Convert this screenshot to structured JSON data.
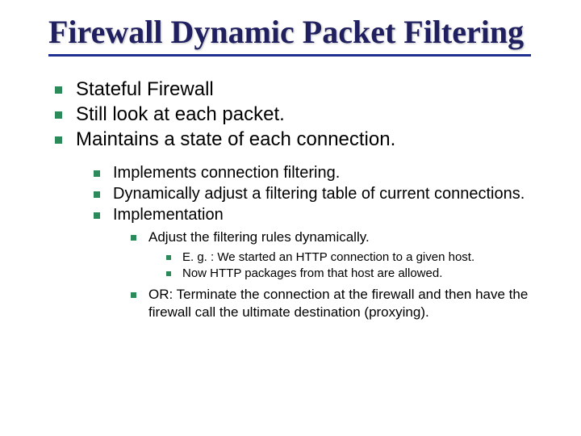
{
  "title": "Firewall Dynamic Packet Filtering",
  "l1": {
    "a": "Stateful Firewall",
    "b": "Still look at each packet.",
    "c": "Maintains a state of each connection."
  },
  "l2": {
    "a": "Implements connection filtering.",
    "b": "Dynamically adjust a filtering table of current connections.",
    "c": "Implementation"
  },
  "l3": {
    "a": "Adjust the filtering rules dynamically."
  },
  "l4": {
    "a": "E. g. : We started an HTTP connection to a given host.",
    "b": "Now HTTP packages from that host are allowed."
  },
  "l3b": {
    "a": "OR: Terminate the connection at the firewall and then have the firewall call the ultimate destination (proxying)."
  }
}
